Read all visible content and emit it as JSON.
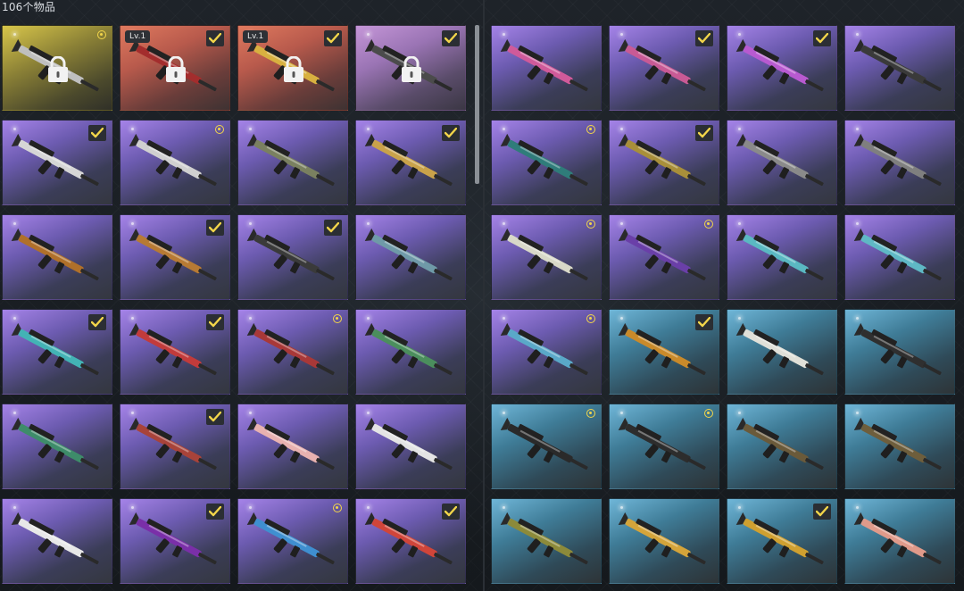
{
  "header": {
    "item_count": "106个物品"
  },
  "colors": {
    "check_tick": "#f2d54a",
    "check_bg": "#2b2e33",
    "dot": "#f2d54a"
  },
  "left_grid": [
    [
      {
        "bg": "gold",
        "badge": "dot",
        "lock": true,
        "lvl": "",
        "gun": "shotgun-camo-icon",
        "tint": "#bfbfbf"
      },
      {
        "bg": "red",
        "badge": "check",
        "lock": true,
        "lvl": "Lv.1",
        "gun": "rifle-red-icon",
        "tint": "#a32d2d"
      },
      {
        "bg": "red",
        "badge": "check",
        "lock": true,
        "lvl": "Lv.1",
        "gun": "shotgun-flag-icon",
        "tint": "#d8b040"
      },
      {
        "bg": "pink",
        "badge": "check",
        "lock": true,
        "lvl": "",
        "gun": "emblem-ring-icon",
        "tint": "#4b4b4b"
      }
    ],
    [
      {
        "bg": "purple",
        "badge": "check",
        "lock": false,
        "lvl": "",
        "gun": "scar-white-icon",
        "tint": "#d6d6d6"
      },
      {
        "bg": "purple",
        "badge": "dot",
        "lock": false,
        "lvl": "",
        "gun": "scar-white-icon",
        "tint": "#d0d0d0"
      },
      {
        "bg": "purple",
        "badge": "",
        "lock": false,
        "lvl": "",
        "gun": "scar-olive-icon",
        "tint": "#7a8060"
      },
      {
        "bg": "purple",
        "badge": "check",
        "lock": false,
        "lvl": "",
        "gun": "groza-gold-icon",
        "tint": "#c9a24a"
      }
    ],
    [
      {
        "bg": "purple",
        "badge": "",
        "lock": false,
        "lvl": "",
        "gun": "kar98-wood-icon",
        "tint": "#b0702a"
      },
      {
        "bg": "purple",
        "badge": "check",
        "lock": false,
        "lvl": "",
        "gun": "kar98-wood-icon",
        "tint": "#b77a34"
      },
      {
        "bg": "purple",
        "badge": "check",
        "lock": false,
        "lvl": "",
        "gun": "m249-black-icon",
        "tint": "#3a3a3a"
      },
      {
        "bg": "purple",
        "badge": "",
        "lock": false,
        "lvl": "",
        "gun": "vector-camo-icon",
        "tint": "#6f9aa8"
      }
    ],
    [
      {
        "bg": "purple",
        "badge": "check",
        "lock": false,
        "lvl": "",
        "gun": "m416-teal-icon",
        "tint": "#43b3b5"
      },
      {
        "bg": "purple",
        "badge": "check",
        "lock": false,
        "lvl": "",
        "gun": "m416-red-icon",
        "tint": "#c23b3b"
      },
      {
        "bg": "purple",
        "badge": "dot",
        "lock": false,
        "lvl": "",
        "gun": "m416-redpattern-icon",
        "tint": "#a83838"
      },
      {
        "bg": "purple",
        "badge": "",
        "lock": false,
        "lvl": "",
        "gun": "m416-green-icon",
        "tint": "#4b8e5d"
      }
    ],
    [
      {
        "bg": "purple",
        "badge": "",
        "lock": false,
        "lvl": "",
        "gun": "m416-greengold-icon",
        "tint": "#3e8c6a"
      },
      {
        "bg": "purple",
        "badge": "check",
        "lock": false,
        "lvl": "",
        "gun": "m416-redcamo-icon",
        "tint": "#a8433a"
      },
      {
        "bg": "purple",
        "badge": "",
        "lock": false,
        "lvl": "",
        "gun": "aug-pink-icon",
        "tint": "#e8b2b0"
      },
      {
        "bg": "purple",
        "badge": "",
        "lock": false,
        "lvl": "",
        "gun": "shotgun-white-icon",
        "tint": "#e4e4e4"
      }
    ],
    [
      {
        "bg": "purple",
        "badge": "",
        "lock": false,
        "lvl": "",
        "gun": "shotgun-white-icon",
        "tint": "#e8e8e8"
      },
      {
        "bg": "purple",
        "badge": "check",
        "lock": false,
        "lvl": "",
        "gun": "p90-purple-icon",
        "tint": "#7a2fa8"
      },
      {
        "bg": "purple",
        "badge": "dot",
        "lock": false,
        "lvl": "",
        "gun": "sniper-blue-icon",
        "tint": "#3f8fd0"
      },
      {
        "bg": "purple",
        "badge": "check",
        "lock": false,
        "lvl": "",
        "gun": "m16-red-icon",
        "tint": "#d0453a"
      }
    ]
  ],
  "right_grid": [
    [
      {
        "bg": "purple",
        "badge": "",
        "lock": false,
        "lvl": "",
        "gun": "smg-pink-icon",
        "tint": "#d05a9a"
      },
      {
        "bg": "purple",
        "badge": "check",
        "lock": false,
        "lvl": "",
        "gun": "smg-pink-icon",
        "tint": "#c85a95"
      },
      {
        "bg": "purple",
        "badge": "check",
        "lock": false,
        "lvl": "",
        "gun": "ar-pinkstripe-icon",
        "tint": "#b85ad0"
      },
      {
        "bg": "purple",
        "badge": "",
        "lock": false,
        "lvl": "",
        "gun": "ar-black-icon",
        "tint": "#3a3a3a"
      }
    ],
    [
      {
        "bg": "purple",
        "badge": "dot",
        "lock": false,
        "lvl": "",
        "gun": "pistol-teal-icon",
        "tint": "#2f7c7a"
      },
      {
        "bg": "purple",
        "badge": "check",
        "lock": false,
        "lvl": "",
        "gun": "famas-gold-icon",
        "tint": "#a88f3a"
      },
      {
        "bg": "purple",
        "badge": "",
        "lock": false,
        "lvl": "",
        "gun": "smg-chrome-icon",
        "tint": "#8a8a8a"
      },
      {
        "bg": "purple",
        "badge": "",
        "lock": false,
        "lvl": "",
        "gun": "smg-chrome-icon",
        "tint": "#7f7f7f"
      }
    ],
    [
      {
        "bg": "purple",
        "badge": "dot",
        "lock": false,
        "lvl": "",
        "gun": "vector-white-icon",
        "tint": "#d8d8c8"
      },
      {
        "bg": "purple",
        "badge": "dot",
        "lock": false,
        "lvl": "",
        "gun": "sks-purple-icon",
        "tint": "#6a3fa8"
      },
      {
        "bg": "purple",
        "badge": "",
        "lock": false,
        "lvl": "",
        "gun": "win-teal-icon",
        "tint": "#5ab8c2"
      },
      {
        "bg": "purple",
        "badge": "",
        "lock": false,
        "lvl": "",
        "gun": "win-teal-icon",
        "tint": "#5fb8c5"
      }
    ],
    [
      {
        "bg": "purple",
        "badge": "dot",
        "lock": false,
        "lvl": "",
        "gun": "win-teal-icon",
        "tint": "#5aa8c8"
      },
      {
        "bg": "blue",
        "badge": "check",
        "lock": false,
        "lvl": "",
        "gun": "sawedoff-gold-icon",
        "tint": "#c98a2a"
      },
      {
        "bg": "blue",
        "badge": "",
        "lock": false,
        "lvl": "",
        "gun": "s686-white-icon",
        "tint": "#e0e0d8"
      },
      {
        "bg": "blue",
        "badge": "",
        "lock": false,
        "lvl": "",
        "gun": "mp5-black-icon",
        "tint": "#2f2f2f"
      }
    ],
    [
      {
        "bg": "blue",
        "badge": "dot",
        "lock": false,
        "lvl": "",
        "gun": "tommy-black-icon",
        "tint": "#2a2a2a"
      },
      {
        "bg": "blue",
        "badge": "dot",
        "lock": false,
        "lvl": "",
        "gun": "tommy-black-icon",
        "tint": "#2d2d2d"
      },
      {
        "bg": "blue",
        "badge": "",
        "lock": false,
        "lvl": "",
        "gun": "s1897-wood-icon",
        "tint": "#6a5a3a"
      },
      {
        "bg": "blue",
        "badge": "",
        "lock": false,
        "lvl": "",
        "gun": "s1897-wood-icon",
        "tint": "#6e5e3c"
      }
    ],
    [
      {
        "bg": "blue",
        "badge": "",
        "lock": false,
        "lvl": "",
        "gun": "ump-olive-icon",
        "tint": "#8c8a3a"
      },
      {
        "bg": "blue",
        "badge": "",
        "lock": false,
        "lvl": "",
        "gun": "crossbow-gold-icon",
        "tint": "#d4a43a"
      },
      {
        "bg": "blue",
        "badge": "check",
        "lock": false,
        "lvl": "",
        "gun": "crossbow-gold-icon",
        "tint": "#cfa030"
      },
      {
        "bg": "blue",
        "badge": "",
        "lock": false,
        "lvl": "",
        "gun": "crossbow-pink-icon",
        "tint": "#e09a8a"
      }
    ]
  ]
}
